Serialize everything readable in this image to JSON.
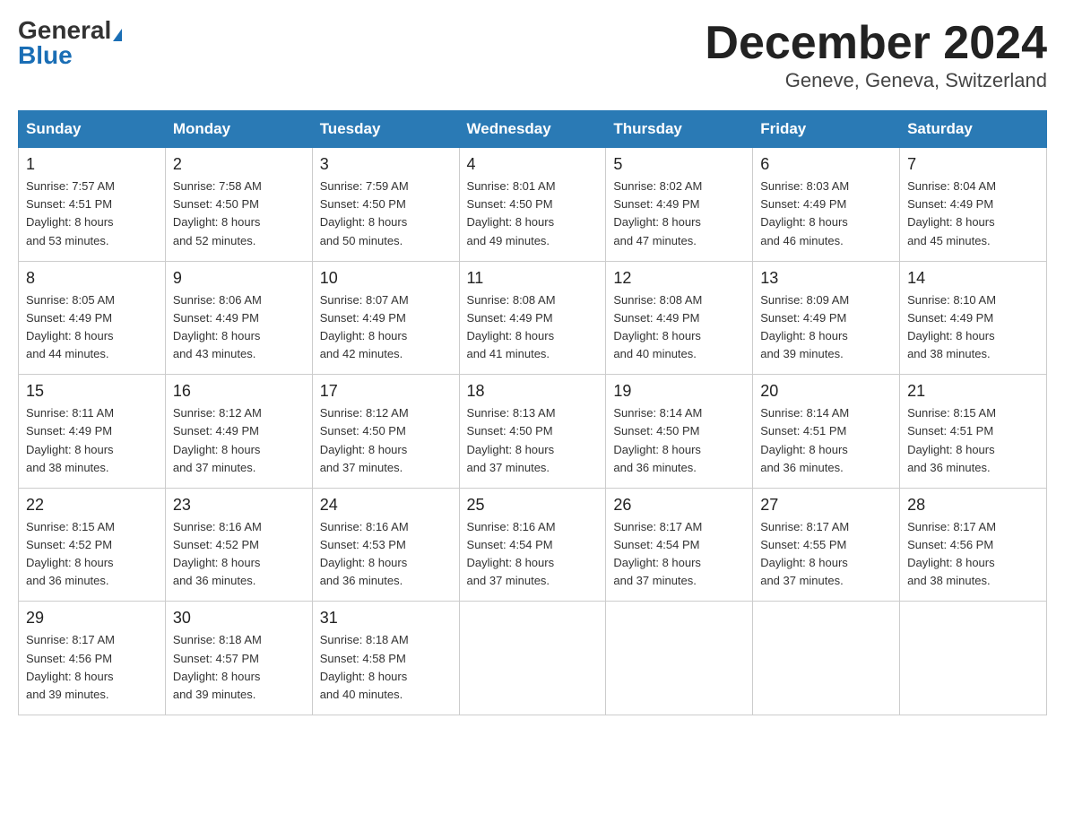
{
  "header": {
    "logo_general": "General",
    "logo_blue": "Blue",
    "month_title": "December 2024",
    "location": "Geneve, Geneva, Switzerland"
  },
  "days_of_week": [
    "Sunday",
    "Monday",
    "Tuesday",
    "Wednesday",
    "Thursday",
    "Friday",
    "Saturday"
  ],
  "weeks": [
    [
      {
        "day": "1",
        "sunrise": "7:57 AM",
        "sunset": "4:51 PM",
        "daylight": "8 hours and 53 minutes."
      },
      {
        "day": "2",
        "sunrise": "7:58 AM",
        "sunset": "4:50 PM",
        "daylight": "8 hours and 52 minutes."
      },
      {
        "day": "3",
        "sunrise": "7:59 AM",
        "sunset": "4:50 PM",
        "daylight": "8 hours and 50 minutes."
      },
      {
        "day": "4",
        "sunrise": "8:01 AM",
        "sunset": "4:50 PM",
        "daylight": "8 hours and 49 minutes."
      },
      {
        "day": "5",
        "sunrise": "8:02 AM",
        "sunset": "4:49 PM",
        "daylight": "8 hours and 47 minutes."
      },
      {
        "day": "6",
        "sunrise": "8:03 AM",
        "sunset": "4:49 PM",
        "daylight": "8 hours and 46 minutes."
      },
      {
        "day": "7",
        "sunrise": "8:04 AM",
        "sunset": "4:49 PM",
        "daylight": "8 hours and 45 minutes."
      }
    ],
    [
      {
        "day": "8",
        "sunrise": "8:05 AM",
        "sunset": "4:49 PM",
        "daylight": "8 hours and 44 minutes."
      },
      {
        "day": "9",
        "sunrise": "8:06 AM",
        "sunset": "4:49 PM",
        "daylight": "8 hours and 43 minutes."
      },
      {
        "day": "10",
        "sunrise": "8:07 AM",
        "sunset": "4:49 PM",
        "daylight": "8 hours and 42 minutes."
      },
      {
        "day": "11",
        "sunrise": "8:08 AM",
        "sunset": "4:49 PM",
        "daylight": "8 hours and 41 minutes."
      },
      {
        "day": "12",
        "sunrise": "8:08 AM",
        "sunset": "4:49 PM",
        "daylight": "8 hours and 40 minutes."
      },
      {
        "day": "13",
        "sunrise": "8:09 AM",
        "sunset": "4:49 PM",
        "daylight": "8 hours and 39 minutes."
      },
      {
        "day": "14",
        "sunrise": "8:10 AM",
        "sunset": "4:49 PM",
        "daylight": "8 hours and 38 minutes."
      }
    ],
    [
      {
        "day": "15",
        "sunrise": "8:11 AM",
        "sunset": "4:49 PM",
        "daylight": "8 hours and 38 minutes."
      },
      {
        "day": "16",
        "sunrise": "8:12 AM",
        "sunset": "4:49 PM",
        "daylight": "8 hours and 37 minutes."
      },
      {
        "day": "17",
        "sunrise": "8:12 AM",
        "sunset": "4:50 PM",
        "daylight": "8 hours and 37 minutes."
      },
      {
        "day": "18",
        "sunrise": "8:13 AM",
        "sunset": "4:50 PM",
        "daylight": "8 hours and 37 minutes."
      },
      {
        "day": "19",
        "sunrise": "8:14 AM",
        "sunset": "4:50 PM",
        "daylight": "8 hours and 36 minutes."
      },
      {
        "day": "20",
        "sunrise": "8:14 AM",
        "sunset": "4:51 PM",
        "daylight": "8 hours and 36 minutes."
      },
      {
        "day": "21",
        "sunrise": "8:15 AM",
        "sunset": "4:51 PM",
        "daylight": "8 hours and 36 minutes."
      }
    ],
    [
      {
        "day": "22",
        "sunrise": "8:15 AM",
        "sunset": "4:52 PM",
        "daylight": "8 hours and 36 minutes."
      },
      {
        "day": "23",
        "sunrise": "8:16 AM",
        "sunset": "4:52 PM",
        "daylight": "8 hours and 36 minutes."
      },
      {
        "day": "24",
        "sunrise": "8:16 AM",
        "sunset": "4:53 PM",
        "daylight": "8 hours and 36 minutes."
      },
      {
        "day": "25",
        "sunrise": "8:16 AM",
        "sunset": "4:54 PM",
        "daylight": "8 hours and 37 minutes."
      },
      {
        "day": "26",
        "sunrise": "8:17 AM",
        "sunset": "4:54 PM",
        "daylight": "8 hours and 37 minutes."
      },
      {
        "day": "27",
        "sunrise": "8:17 AM",
        "sunset": "4:55 PM",
        "daylight": "8 hours and 37 minutes."
      },
      {
        "day": "28",
        "sunrise": "8:17 AM",
        "sunset": "4:56 PM",
        "daylight": "8 hours and 38 minutes."
      }
    ],
    [
      {
        "day": "29",
        "sunrise": "8:17 AM",
        "sunset": "4:56 PM",
        "daylight": "8 hours and 39 minutes."
      },
      {
        "day": "30",
        "sunrise": "8:18 AM",
        "sunset": "4:57 PM",
        "daylight": "8 hours and 39 minutes."
      },
      {
        "day": "31",
        "sunrise": "8:18 AM",
        "sunset": "4:58 PM",
        "daylight": "8 hours and 40 minutes."
      },
      null,
      null,
      null,
      null
    ]
  ],
  "labels": {
    "sunrise": "Sunrise:",
    "sunset": "Sunset:",
    "daylight": "Daylight:"
  }
}
